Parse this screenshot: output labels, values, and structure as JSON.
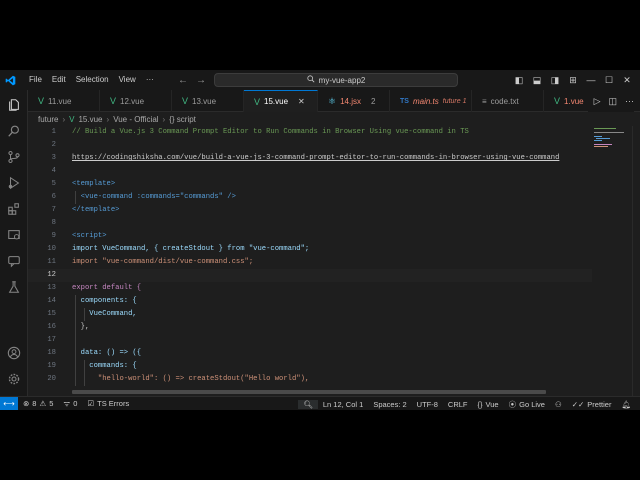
{
  "titlebar": {
    "menu": [
      "File",
      "Edit",
      "Selection",
      "View",
      "···"
    ],
    "search_text": "my-vue-app2"
  },
  "tabs": [
    {
      "label": "11.vue",
      "kind": "vue",
      "active": false
    },
    {
      "label": "12.vue",
      "kind": "vue",
      "active": false
    },
    {
      "label": "13.vue",
      "kind": "vue",
      "active": false
    },
    {
      "label": "15.vue",
      "kind": "vue",
      "active": true
    },
    {
      "label": "14.jsx",
      "kind": "jsx",
      "active": false,
      "count": "2"
    },
    {
      "label": "main.ts",
      "kind": "ts",
      "active": false,
      "note": "future 1"
    },
    {
      "label": "code.txt",
      "kind": "txt",
      "active": false
    },
    {
      "label": "1.vue",
      "kind": "vue",
      "active": false
    }
  ],
  "breadcrumb": [
    "future",
    "15.vue",
    "Vue - Official",
    "{} script"
  ],
  "editor": {
    "current_line": "12",
    "lines": [
      {
        "n": "1",
        "text": "// Build a Vue.js 3 Command Prompt Editor to Run Commands in Browser Using vue-command in TS"
      },
      {
        "n": "2",
        "text": ""
      },
      {
        "n": "3",
        "text": "https://codingshiksha.com/vue/build-a-vue-js-3-command-prompt-editor-to-run-commands-in-browser-using-vue-command"
      },
      {
        "n": "4",
        "text": ""
      },
      {
        "n": "5",
        "text": "<template>"
      },
      {
        "n": "6",
        "text": "  <vue-command :commands=\"commands\" />"
      },
      {
        "n": "7",
        "text": "</template>"
      },
      {
        "n": "8",
        "text": ""
      },
      {
        "n": "9",
        "text": "<script>"
      },
      {
        "n": "10",
        "text": "import VueCommand, { createStdout } from \"vue-command\";"
      },
      {
        "n": "11",
        "text": "import \"vue-command/dist/vue-command.css\";"
      },
      {
        "n": "12",
        "text": ""
      },
      {
        "n": "13",
        "text": "export default {"
      },
      {
        "n": "14",
        "text": "  components: {"
      },
      {
        "n": "15",
        "text": "    VueCommand,"
      },
      {
        "n": "16",
        "text": "  },"
      },
      {
        "n": "17",
        "text": ""
      },
      {
        "n": "18",
        "text": "  data: () => ({"
      },
      {
        "n": "19",
        "text": "    commands: {"
      },
      {
        "n": "20",
        "text": "      \"hello-world\": () => createStdout(\"Hello world\"),"
      }
    ]
  },
  "statusbar": {
    "errors": "8",
    "warnings": "5",
    "info": "0",
    "ts_errors": "TS Errors",
    "position": "Ln 12, Col 1",
    "spaces": "Spaces: 2",
    "encoding": "UTF-8",
    "eol": "CRLF",
    "language": "Vue",
    "golive": "Go Live",
    "prettier": "Prettier"
  },
  "colors": {
    "accent": "#0078d4",
    "vue": "#41b883",
    "ts": "#3178c6",
    "error": "#f48771"
  }
}
